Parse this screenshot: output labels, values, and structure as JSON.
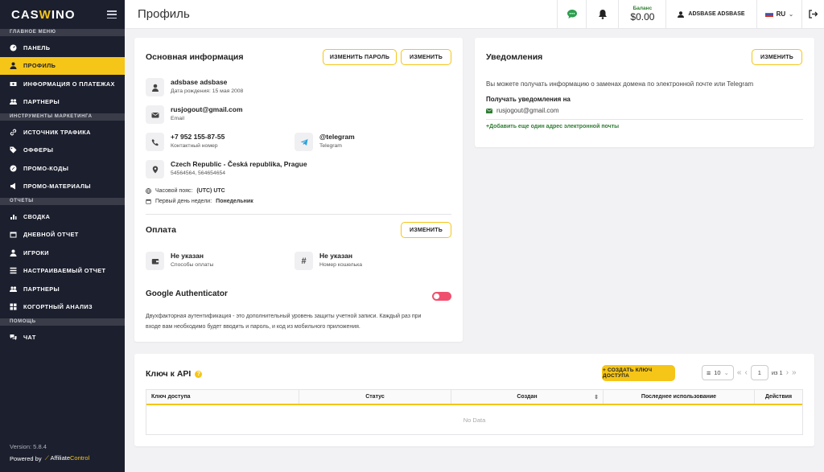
{
  "brand": {
    "logo_left": "CAS",
    "logo_w": "W",
    "logo_right": "INO"
  },
  "colors": {
    "accent": "#f5c518",
    "sidebar": "#1c1f2e",
    "green": "#2e7d32",
    "toggle_off": "#f0506e"
  },
  "sidebar": {
    "sections": [
      {
        "title": "ГЛАВНОЕ МЕНЮ",
        "items": [
          {
            "label": "ПАНЕЛЬ",
            "icon": "dashboard-icon"
          },
          {
            "label": "ПРОФИЛЬ",
            "icon": "user-icon",
            "active": true
          },
          {
            "label": "ИНФОРМАЦИЯ О ПЛАТЕЖАХ",
            "icon": "money-icon"
          },
          {
            "label": "ПАРТНЕРЫ",
            "icon": "users-icon"
          }
        ]
      },
      {
        "title": "ИНСТРУМЕНТЫ МАРКЕТИНГА",
        "items": [
          {
            "label": "ИСТОЧНИК ТРАФИКА",
            "icon": "link-icon"
          },
          {
            "label": "ОФФЕРЫ",
            "icon": "tag-icon"
          },
          {
            "label": "ПРОМО-КОДЫ",
            "icon": "percent-icon"
          },
          {
            "label": "ПРОМО-МАТЕРИАЛЫ",
            "icon": "megaphone-icon"
          }
        ]
      },
      {
        "title": "ОТЧЕТЫ",
        "items": [
          {
            "label": "СВОДКА",
            "icon": "chart-icon"
          },
          {
            "label": "ДНЕВНОЙ ОТЧЕТ",
            "icon": "calendar-icon"
          },
          {
            "label": "ИГРОКИ",
            "icon": "player-icon"
          },
          {
            "label": "НАСТРАИВАЕМЫЙ ОТЧЕТ",
            "icon": "list-icon"
          },
          {
            "label": "ПАРТНЕРЫ",
            "icon": "users-icon"
          },
          {
            "label": "КОГОРТНЫЙ АНАЛИЗ",
            "icon": "grid-icon"
          }
        ]
      },
      {
        "title": "ПОМОЩЬ",
        "items": [
          {
            "label": "ЧАТ",
            "icon": "chat-icon"
          }
        ]
      }
    ],
    "version": "Version: 5.8.4",
    "powered": "Powered by",
    "powered_brand_a": "Affiliate",
    "powered_brand_b": "Control"
  },
  "topbar": {
    "title": "Профиль",
    "balance_label": "Баланс",
    "balance_value": "$0.00",
    "user": "ADSBASE ADSBASE",
    "lang": "RU"
  },
  "basic": {
    "title": "Основная информация",
    "change_password": "ИЗМЕНИТЬ ПАРОЛЬ",
    "edit": "ИЗМЕНИТЬ",
    "name": "adsbase adsbase",
    "birth": "Дата рождения: 15 мая 2008",
    "email": "rusjogout@gmail.com",
    "email_label": "Email",
    "phone": "+7 952 155-87-55",
    "phone_label": "Контактный номер",
    "telegram": "@telegram",
    "telegram_label": "Telegram",
    "address": "Czech Republic - Česká republika, Prague",
    "address_sub": "54564564, 564654654",
    "tz_label": "Часовой пояс:",
    "tz_value": "(UTC) UTC",
    "week_label": "Первый день недели:",
    "week_value": "Понедельник"
  },
  "payment": {
    "title": "Оплата",
    "edit": "ИЗМЕНИТЬ",
    "method_value": "Не указан",
    "method_label": "Способы оплаты",
    "wallet_value": "Не указан",
    "wallet_label": "Номер кошелька"
  },
  "ga": {
    "title": "Google Authenticator",
    "enabled": false,
    "text1": "Двухфакторная аутентификация - это дополнительный уровень защиты учетной записи. Каждый раз при",
    "text2": "входе вам необходимо будет вводить и пароль, и код из мобильного приложения."
  },
  "notifications": {
    "title": "Уведомления",
    "edit": "ИЗМЕНИТЬ",
    "text": "Вы можете получать информацию о заменах домена по электронной почте или Telegram",
    "receive_title": "Получать уведомления на",
    "email": "rusjogout@gmail.com",
    "add": "+Добавить еще один адрес электронной почты"
  },
  "api": {
    "title": "Ключ к API",
    "create": "+ СОЗДАТЬ КЛЮЧ ДОСТУПА",
    "page_size": "10",
    "page": "1",
    "of": "из 1",
    "columns": [
      "Ключ доступа",
      "Статус",
      "Создан",
      "Последнее использование",
      "Действия"
    ],
    "empty": "No Data"
  }
}
